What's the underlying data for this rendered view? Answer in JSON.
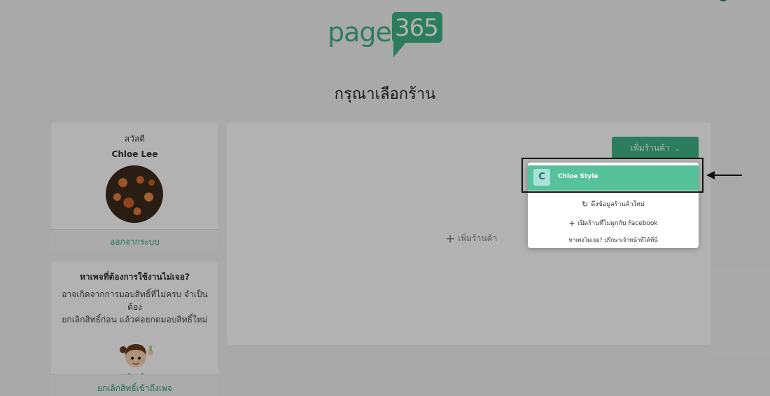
{
  "logo": {
    "word": "page",
    "number": "365"
  },
  "page_title": "กรุณาเลือกร้าน",
  "profile": {
    "greeting": "สวัสดี",
    "name": "Chloe Lee",
    "logout_label": "ออกจากระบบ"
  },
  "help": {
    "title": "หาเพจที่ต้องการใช้งานไม่เจอ?",
    "line1": "อาจเกิดจากการมอบสิทธิ์ที่ไม่ครบ จำเป็นต้อง",
    "line2": "ยกเลิกสิทธิ์ก่อน แล้วค่อยกดมอบสิทธิ์ใหม่",
    "revoke_label": "ยกเลิกสิทธิ์เข้าถึงเพจ"
  },
  "main": {
    "add_shop_center_label": "เพิ่มร้านค้า",
    "add_shop_button_label": "เพิ่มร้านค้า"
  },
  "dropdown": {
    "shop": {
      "initial": "C",
      "name": "Chloe Style"
    },
    "sync_label": "ดึงข้อมูลร้านค้าใหม่",
    "open_without_fb_label": "เปิดร้านที่ไม่ผูกกับ Facebook",
    "help_link_label": "หาเพจไม่เจอ? ปรึกษาเจ้าหน้าที่ได้ที่นี่"
  },
  "colors": {
    "accent": "#3fb48a",
    "selected_item": "#56c29b",
    "link": "#2f9e78"
  },
  "icons": {
    "sync": "refresh-icon",
    "add": "plus-icon",
    "dropdown": "chevron-down-icon"
  }
}
